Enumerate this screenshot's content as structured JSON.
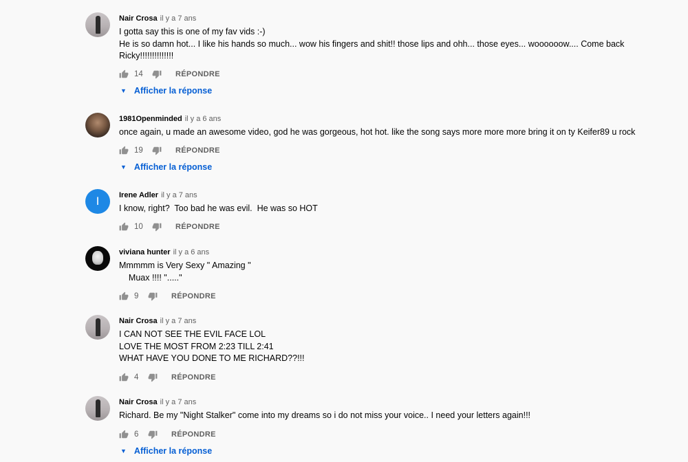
{
  "comments": [
    {
      "author": "Nair Crosa",
      "time": "il y a 7 ans",
      "text": "I gotta say this is one of my fav vids :-)\nHe is so damn hot... I like his hands so much... wow his fingers and shit!! those lips and ohh... those eyes... woooooow.... Come back Ricky!!!!!!!!!!!!!!",
      "likes": "14",
      "reply_label": "RÉPONDRE",
      "show_replies": "Afficher la réponse"
    },
    {
      "author": "1981Openminded",
      "time": "il y a 6 ans",
      "text": "once again, u made an awesome video, god he was gorgeous, hot hot. like the song says more more more bring it on ty Keifer89 u rock",
      "likes": "19",
      "reply_label": "RÉPONDRE",
      "show_replies": "Afficher la réponse"
    },
    {
      "author": "Irene Adler",
      "avatar_letter": "I",
      "time": "il y a 7 ans",
      "text": "I know, right?  Too bad he was evil.  He was so HOT",
      "likes": "10",
      "reply_label": "RÉPONDRE"
    },
    {
      "author": "viviana hunter",
      "time": "il y a 6 ans",
      "text": "Mmmmm is Very Sexy \" Amazing \"\n    Muax !!!! \".....\"",
      "likes": "9",
      "reply_label": "RÉPONDRE"
    },
    {
      "author": "Nair Crosa",
      "time": "il y a 7 ans",
      "text": "I CAN NOT SEE THE EVIL FACE LOL\nLOVE THE MOST FROM 2:23 TILL 2:41\nWHAT HAVE YOU DONE TO ME RICHARD??!!!",
      "likes": "4",
      "reply_label": "RÉPONDRE"
    },
    {
      "author": "Nair Crosa",
      "time": "il y a 7 ans",
      "text": "Richard. Be my \"Night Stalker\" come into my dreams so i do not miss your voice.. I need your letters again!!!",
      "likes": "6",
      "reply_label": "RÉPONDRE",
      "show_replies": "Afficher la réponse"
    }
  ],
  "colors": {
    "background": "#f9f9f9",
    "link_blue": "#065fd4",
    "avatar_blue": "#1e88e5",
    "secondary_text": "#606060"
  },
  "icons": {
    "like": "thumbs-up-icon",
    "dislike": "thumbs-down-icon",
    "expand": "caret-down-icon"
  }
}
